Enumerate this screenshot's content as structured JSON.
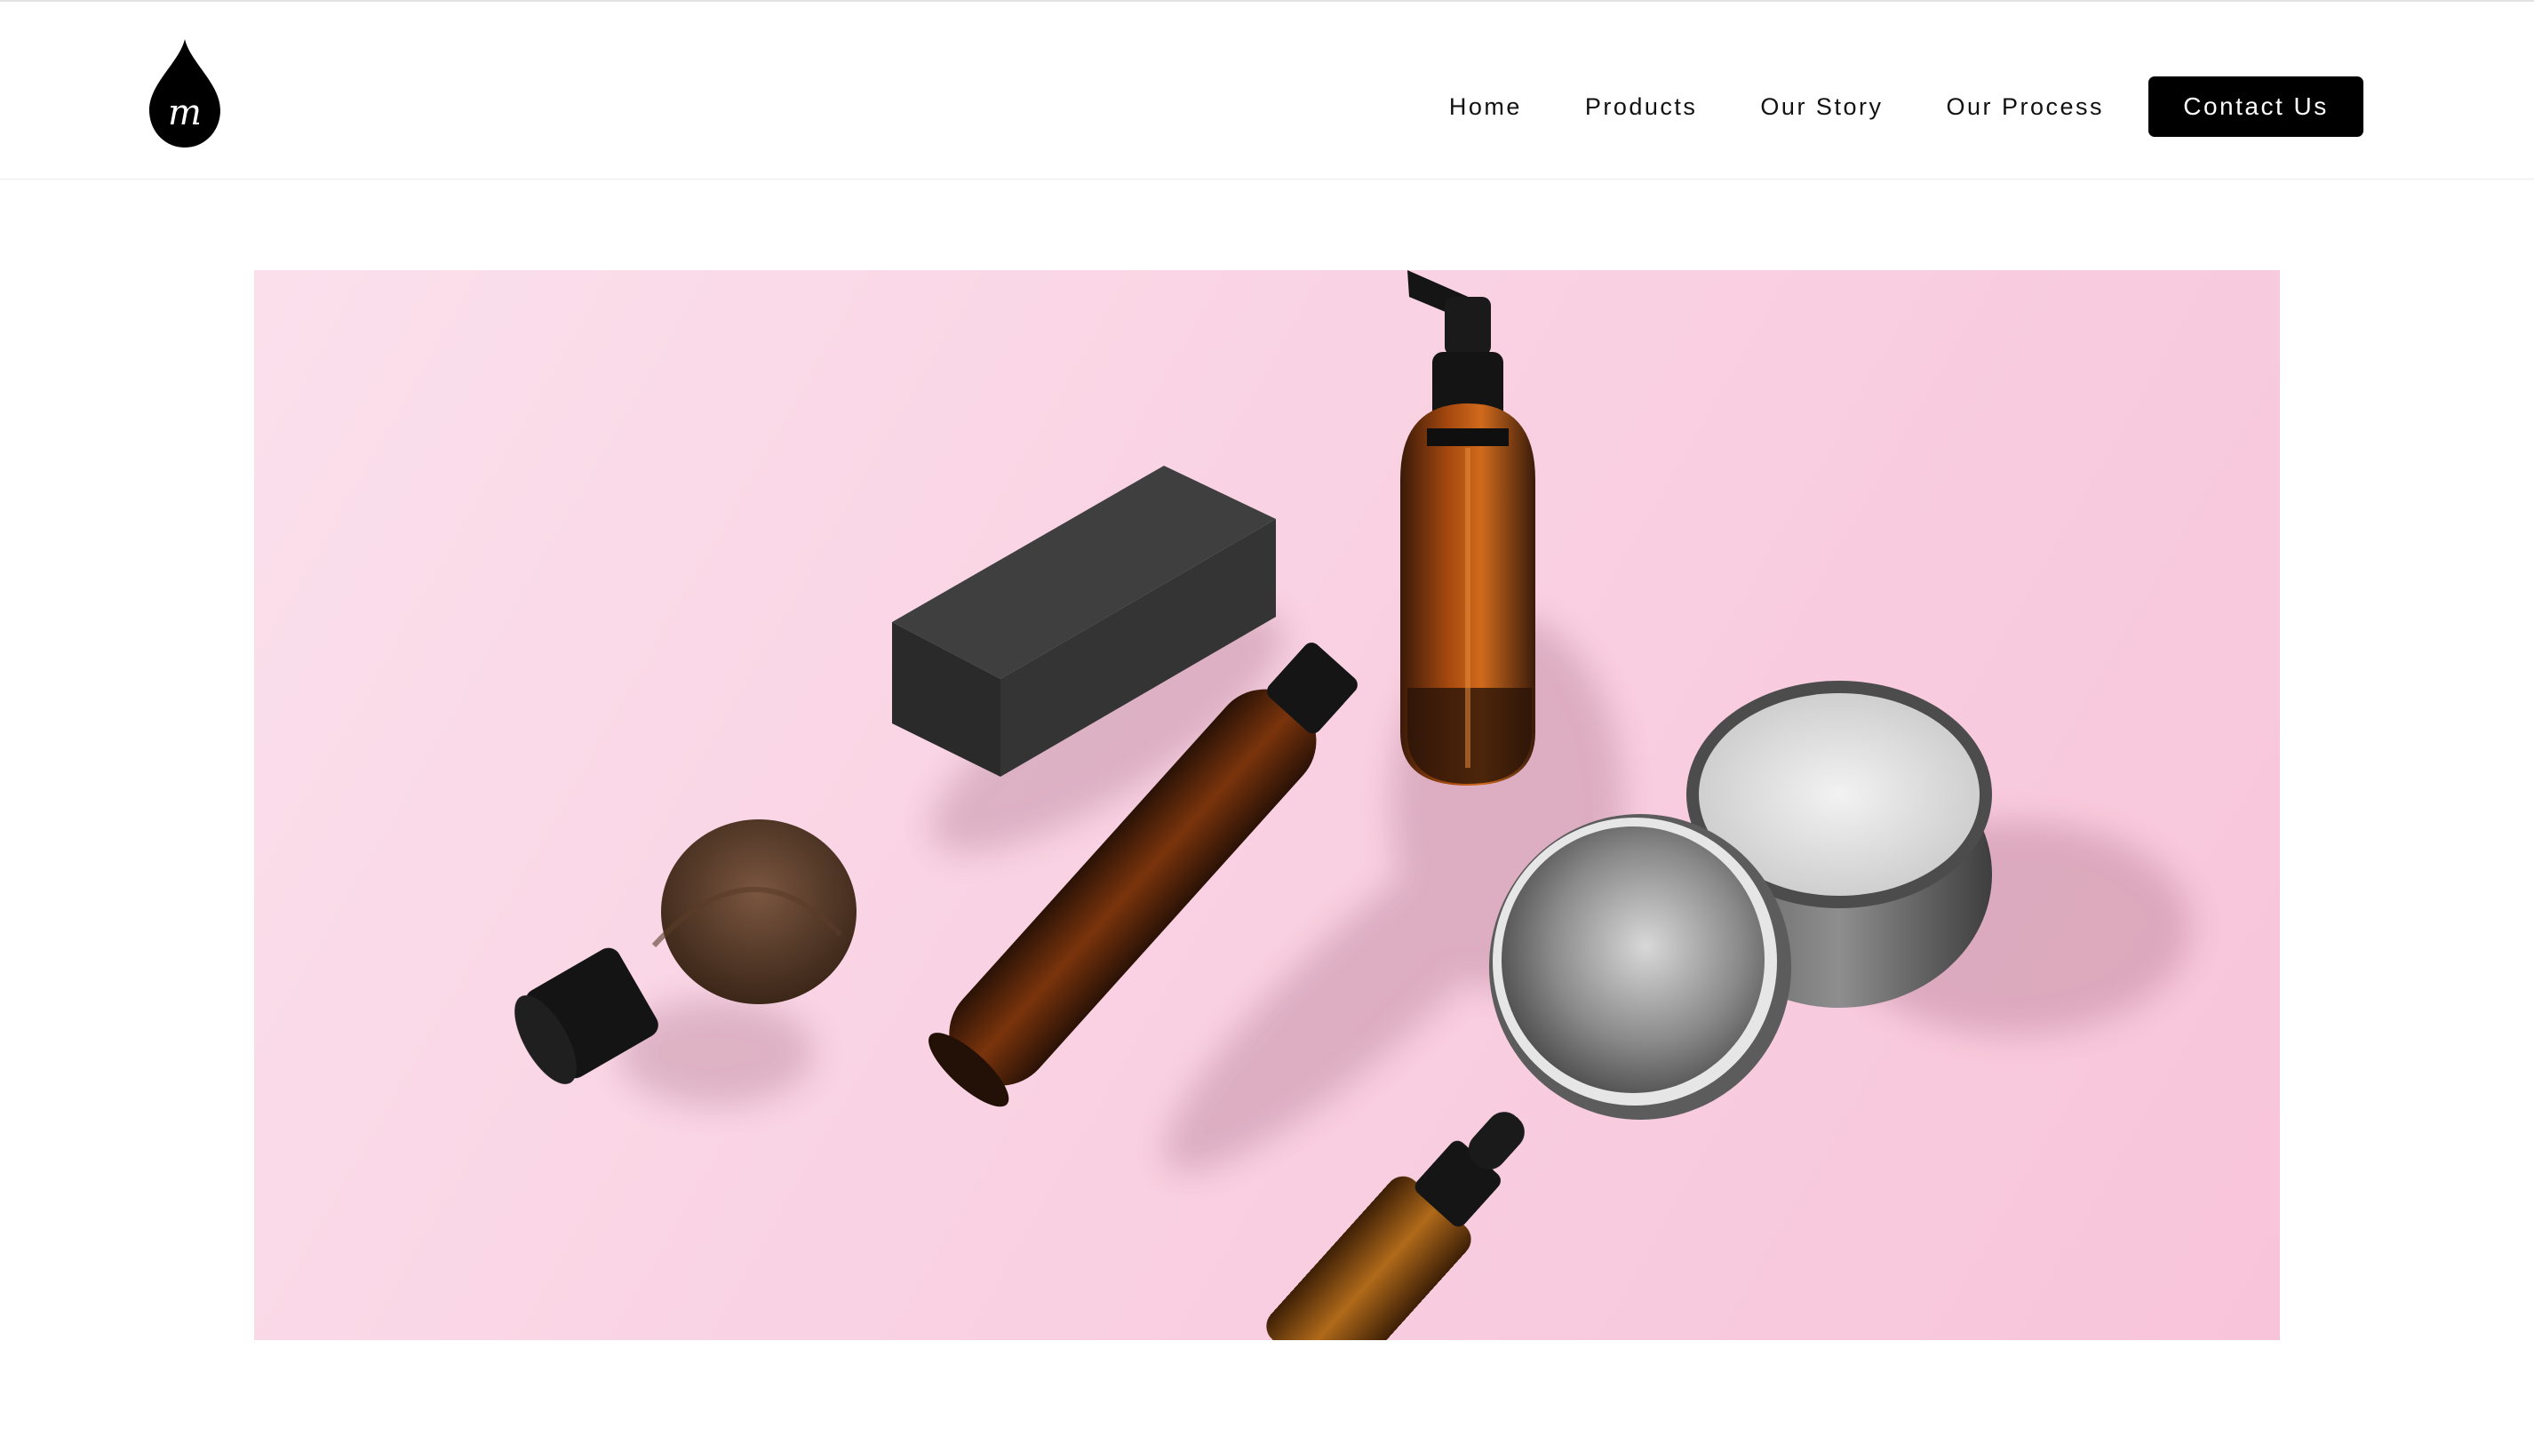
{
  "header": {
    "logo": {
      "icon": "drop-logo-icon",
      "letter": "m"
    },
    "nav": {
      "items": [
        {
          "label": "Home"
        },
        {
          "label": "Products"
        },
        {
          "label": "Our Story"
        },
        {
          "label": "Our Process"
        }
      ],
      "cta_label": "Contact Us"
    }
  },
  "hero": {
    "image_subject": "cosmetic-products-flatlay",
    "background_color": "#f9d2e3"
  },
  "colors": {
    "accent": "#000000",
    "text": "#111111",
    "background": "#ffffff"
  }
}
